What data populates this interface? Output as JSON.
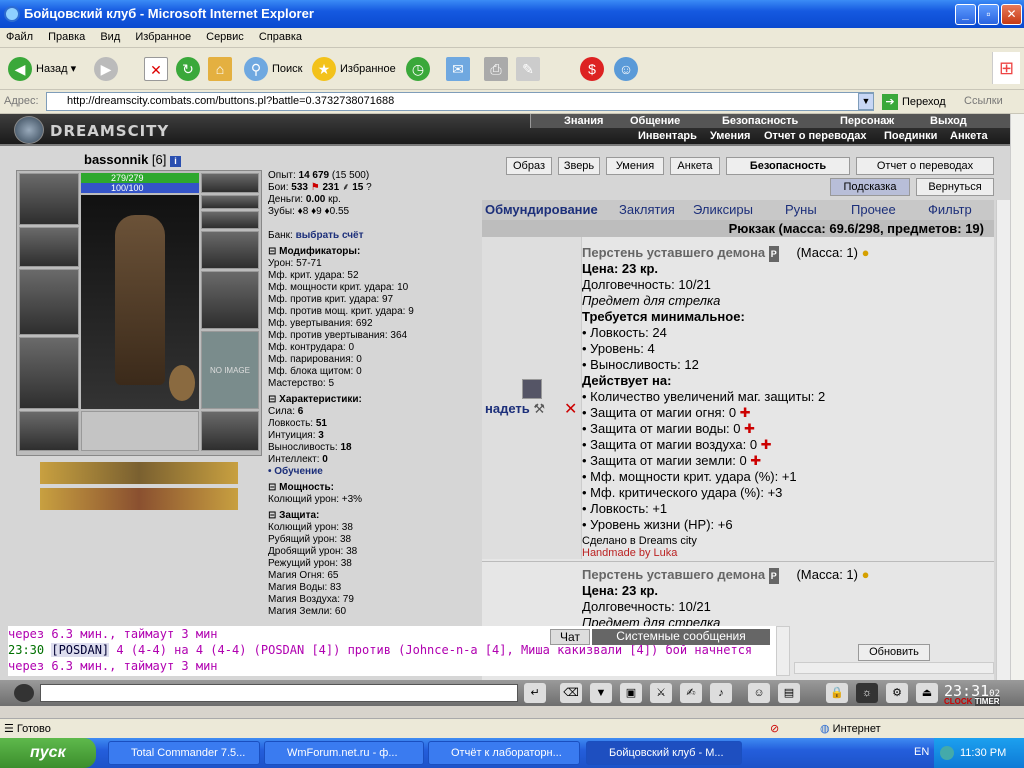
{
  "window": {
    "title": "Бойцовский клуб - Microsoft Internet Explorer",
    "min": "_",
    "max": "▫",
    "close": "✕"
  },
  "menu": [
    "Файл",
    "Правка",
    "Вид",
    "Избранное",
    "Сервис",
    "Справка"
  ],
  "toolbar": {
    "back": "Назад",
    "search": "Поиск",
    "favorites": "Избранное"
  },
  "address": {
    "label": "Адрес:",
    "url": "http://dreamscity.combats.com/buttons.pl?battle=0.3732738071688",
    "go": "Переход",
    "links": "Ссылки"
  },
  "site": {
    "logo": "DREAMSCITY",
    "nav1": [
      "Знания",
      "Общение",
      "Безопасность",
      "Персонаж",
      "Выход"
    ],
    "nav2": [
      "Инвентарь",
      "Умения",
      "Отчет о переводах",
      "Поединки",
      "Анкета"
    ]
  },
  "character": {
    "name": "bassonnik",
    "level": "[6]",
    "hp": "279/279",
    "mana": "100/100",
    "noimage": "NO IMAGE"
  },
  "stats": {
    "exp_label": "Опыт:",
    "exp": "14 679",
    "exp_next": "(15 500)",
    "fights_label": "Бои:",
    "fights_win": "533",
    "fights_lose": "231",
    "fights_draw": "15",
    "money_label": "Деньги:",
    "money": "0.00",
    "money_unit": "кр.",
    "teeth_label": "Зубы:",
    "teeth": "♦8 ♦9 ♦0.55",
    "bank_label": "Банк:",
    "bank_link": "выбрать счёт",
    "modifiers_head": "Модификаторы:",
    "modifiers": [
      "Урон: 57-71",
      "Мф. крит. удара: 52",
      "Мф. мощности крит. удара: 10",
      "Мф. против крит. удара: 97",
      "Мф. против мощ. крит. удара: 9",
      "Мф. увертывания: 692",
      "Мф. против увертывания: 364",
      "Мф. контрудара: 0",
      "Мф. парирования: 0",
      "Мф. блока щитом: 0",
      "Мастерство: 5"
    ],
    "chars_head": "Характеристики:",
    "chars": [
      {
        "k": "Сила: ",
        "v": "6"
      },
      {
        "k": "Ловкость: ",
        "v": "51"
      },
      {
        "k": "Интуиция: ",
        "v": "3"
      },
      {
        "k": "Выносливость: ",
        "v": "18"
      },
      {
        "k": "Интеллект: ",
        "v": "0"
      }
    ],
    "training": "• Обучение",
    "power_head": "Мощность:",
    "power": [
      "Колющий урон: +3%"
    ],
    "defense_head": "Защита:",
    "defense": [
      "Колющий урон: 38",
      "Рубящий урон: 38",
      "Дробящий урон: 38",
      "Режущий урон: 38",
      "Магия Огня: 65",
      "Магия Воды: 83",
      "Магия Воздуха: 79",
      "Магия Земли: 60"
    ]
  },
  "buttons": [
    "Образ",
    "Зверь",
    "Умения",
    "Анкета",
    "Безопасность",
    "Отчет о переводах"
  ],
  "buttons2": [
    "Подсказка",
    "Вернуться"
  ],
  "tabs": [
    "Обмундирование",
    "Заклятия",
    "Эликсиры",
    "Руны",
    "Прочее",
    "Фильтр"
  ],
  "backpack": "Рюкзак (масса: 69.6/298, предметов: 19)",
  "item": {
    "name": "Перстень уставшего демона",
    "mass": "(Масса: 1)",
    "price": "Цена: 23 кр.",
    "durability": "Долговечность: 10/21",
    "for": "Предмет для стрелка",
    "req_head": "Требуется минимальное:",
    "req": [
      "• Ловкость: 24",
      "• Уровень: 4",
      "• Выносливость: 12"
    ],
    "eff_head": "Действует на:",
    "eff": [
      "• Количество увеличений маг. защиты: 2",
      "• Защита от магии огня: 0",
      "• Защита от магии воды: 0",
      "• Защита от магии воздуха: 0",
      "• Защита от магии земли: 0",
      "• Мф. мощности крит. удара (%): +1",
      "• Мф. критического удара (%): +3",
      "• Ловкость: +1",
      "• Уровень жизни (HP): +6"
    ],
    "made": "Сделано в Dreams city",
    "handmade": "Handmade by Luka",
    "wear": "надеть",
    "price2": "Цена: 23 кр.",
    "durability2": "Долговечность: 10/21",
    "for2": "Предмет для стрелка"
  },
  "chat": {
    "tab1": "Чат",
    "tab2": "Системные сообщения",
    "refresh": "Обновить",
    "line1": "через 6.3 мин., таймаут 3 мин",
    "time2": "23:30",
    "user2": "[POSDAN]",
    "text2": " 4 (4-4) на 4 (4-4) (POSDAN [4]) против (Johnce-n-a [4], Миша какизвали [4]) бой начнется",
    "line3": "через 6.3 мин., таймаут 3 мин"
  },
  "clock": "23:31",
  "clock_sec": "02",
  "clock_labels": [
    "CLOCK",
    "TIMER"
  ],
  "status": {
    "ready": "Готово",
    "zone": "Интернет"
  },
  "taskbar": {
    "start": "пуск",
    "tasks": [
      "Total Commander 7.5...",
      "WmForum.net.ru - ф...",
      "Отчёт к лабораторн...",
      "Бойцовский клуб - М..."
    ],
    "lang": "EN",
    "time": "11:30 PM"
  }
}
